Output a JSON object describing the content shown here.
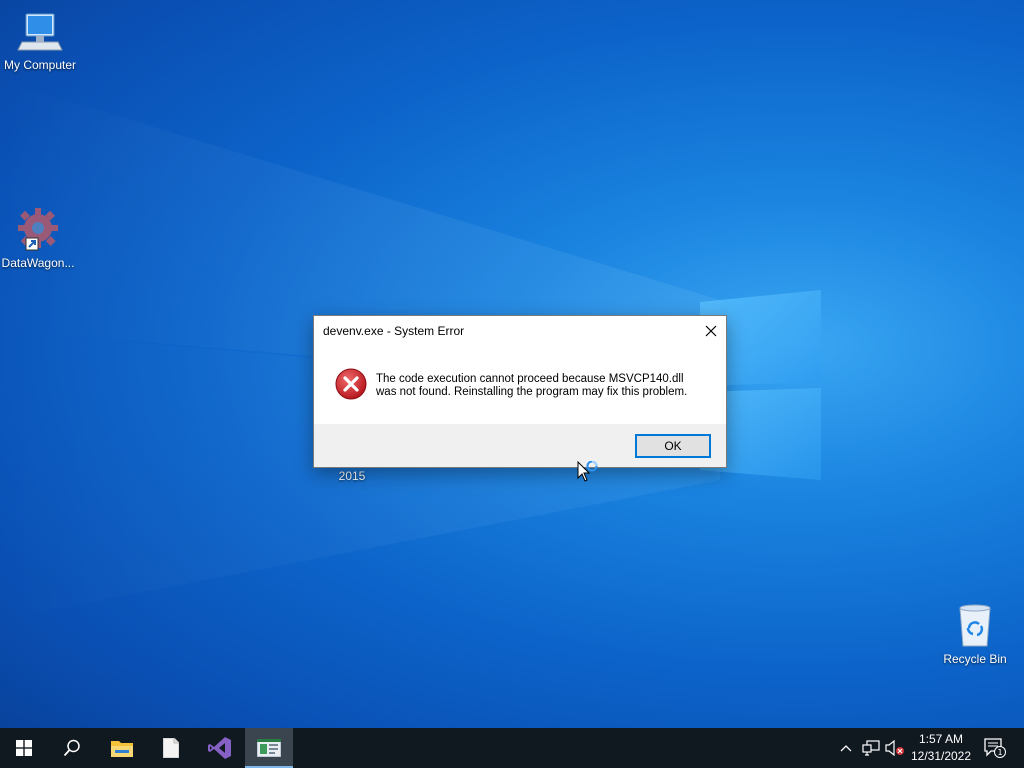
{
  "desktop": {
    "icons": [
      {
        "label": "My Computer",
        "icon": "computer-icon"
      },
      {
        "label": "DataWagon...",
        "icon": "datawagon-gear-icon"
      },
      {
        "label": "Recycle Bin",
        "icon": "recycle-bin-icon"
      }
    ],
    "partial_label": "2015"
  },
  "dialog": {
    "title": "devenv.exe - System Error",
    "message_line1": "The code execution cannot proceed because MSVCP140.dll",
    "message_line2": "was not found. Reinstalling the program may fix this problem.",
    "ok_label": "OK",
    "icon": "error-icon"
  },
  "taskbar": {
    "buttons": [
      "windows-start-icon",
      "search-icon",
      "file-explorer-icon",
      "notepad-icon",
      "visual-studio-icon",
      "app-window-icon"
    ],
    "clock": {
      "time": "1:57 AM",
      "date": "12/31/2022"
    },
    "notification_count": "1"
  },
  "colors": {
    "taskbar_bg": "#101820",
    "error_red": "#c42b1c",
    "accent": "#0078d7"
  }
}
